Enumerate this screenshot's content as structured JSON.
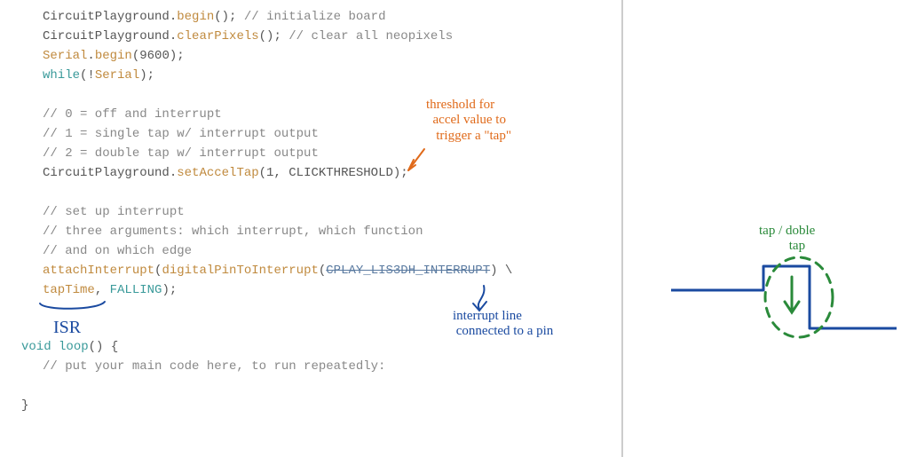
{
  "code": {
    "l1_a": "CircuitPlayground.",
    "l1_b": "begin",
    "l1_c": "(); ",
    "l1_d": "// initialize board",
    "l2_a": "CircuitPlayground.",
    "l2_b": "clearPixels",
    "l2_c": "(); ",
    "l2_d": "// clear all neopixels",
    "l3_a": "Serial",
    "l3_b": ".",
    "l3_c": "begin",
    "l3_d": "(9600);",
    "l4_a": "while",
    "l4_b": "(!",
    "l4_c": "Serial",
    "l4_d": ");",
    "l5": " ",
    "l6": "// 0 = off and interrupt",
    "l7": "// 1 = single tap w/ interrupt output",
    "l8": "// 2 = double tap w/ interrupt output",
    "l9_a": "CircuitPlayground.",
    "l9_b": "setAccelTap",
    "l9_c": "(1, CLICKTHRESHOLD);",
    "l10": " ",
    "l11": "// set up interrupt",
    "l12": "// three arguments: which interrupt, which function",
    "l13": "// and on which edge",
    "l14_a": "attachInterrupt",
    "l14_b": "(",
    "l14_c": "digitalPinToInterrupt",
    "l14_d": "(",
    "l14_e": "CPLAY_LIS3DH_INTERRUPT",
    "l14_f": ") \\",
    "l15_a": "tapTime",
    "l15_b": ", ",
    "l15_c": "FALLING",
    "l15_d": ");",
    "l17_a": "void",
    "l17_b": " ",
    "l17_c": "loop",
    "l17_d": "() {",
    "l18": "// put your main code here, to run repeatedly:",
    "l19": " ",
    "l20": "}"
  },
  "annotations": {
    "threshold": "threshold for\n  accel value to\n   trigger a \"tap\"",
    "isr": "ISR",
    "interrupt_line": "interrupt line\n connected to a pin",
    "tap_double": "tap / doble\n         tap"
  }
}
